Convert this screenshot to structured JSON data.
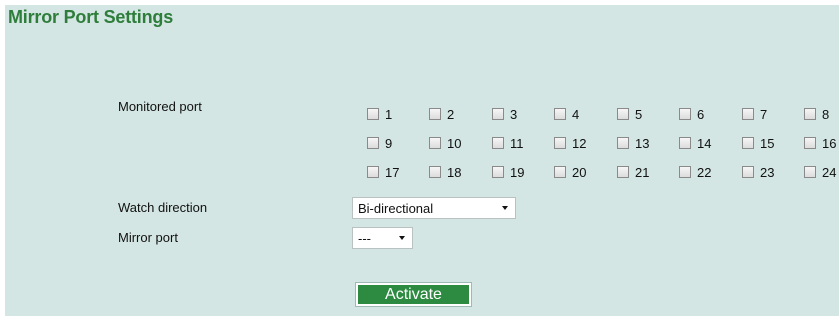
{
  "page": {
    "title": "Mirror Port Settings"
  },
  "monitored": {
    "label": "Monitored port",
    "ports": [
      "1",
      "2",
      "3",
      "4",
      "5",
      "6",
      "7",
      "8",
      "9",
      "10",
      "11",
      "12",
      "13",
      "14",
      "15",
      "16",
      "17",
      "18",
      "19",
      "20",
      "21",
      "22",
      "23",
      "24"
    ]
  },
  "watch": {
    "label": "Watch direction",
    "value": "Bi-directional"
  },
  "mirror": {
    "label": "Mirror port",
    "value": "---"
  },
  "actions": {
    "activate": "Activate"
  },
  "colors": {
    "background": "#d3e6e3",
    "title": "#2e7d3b",
    "button": "#2c8a41"
  }
}
